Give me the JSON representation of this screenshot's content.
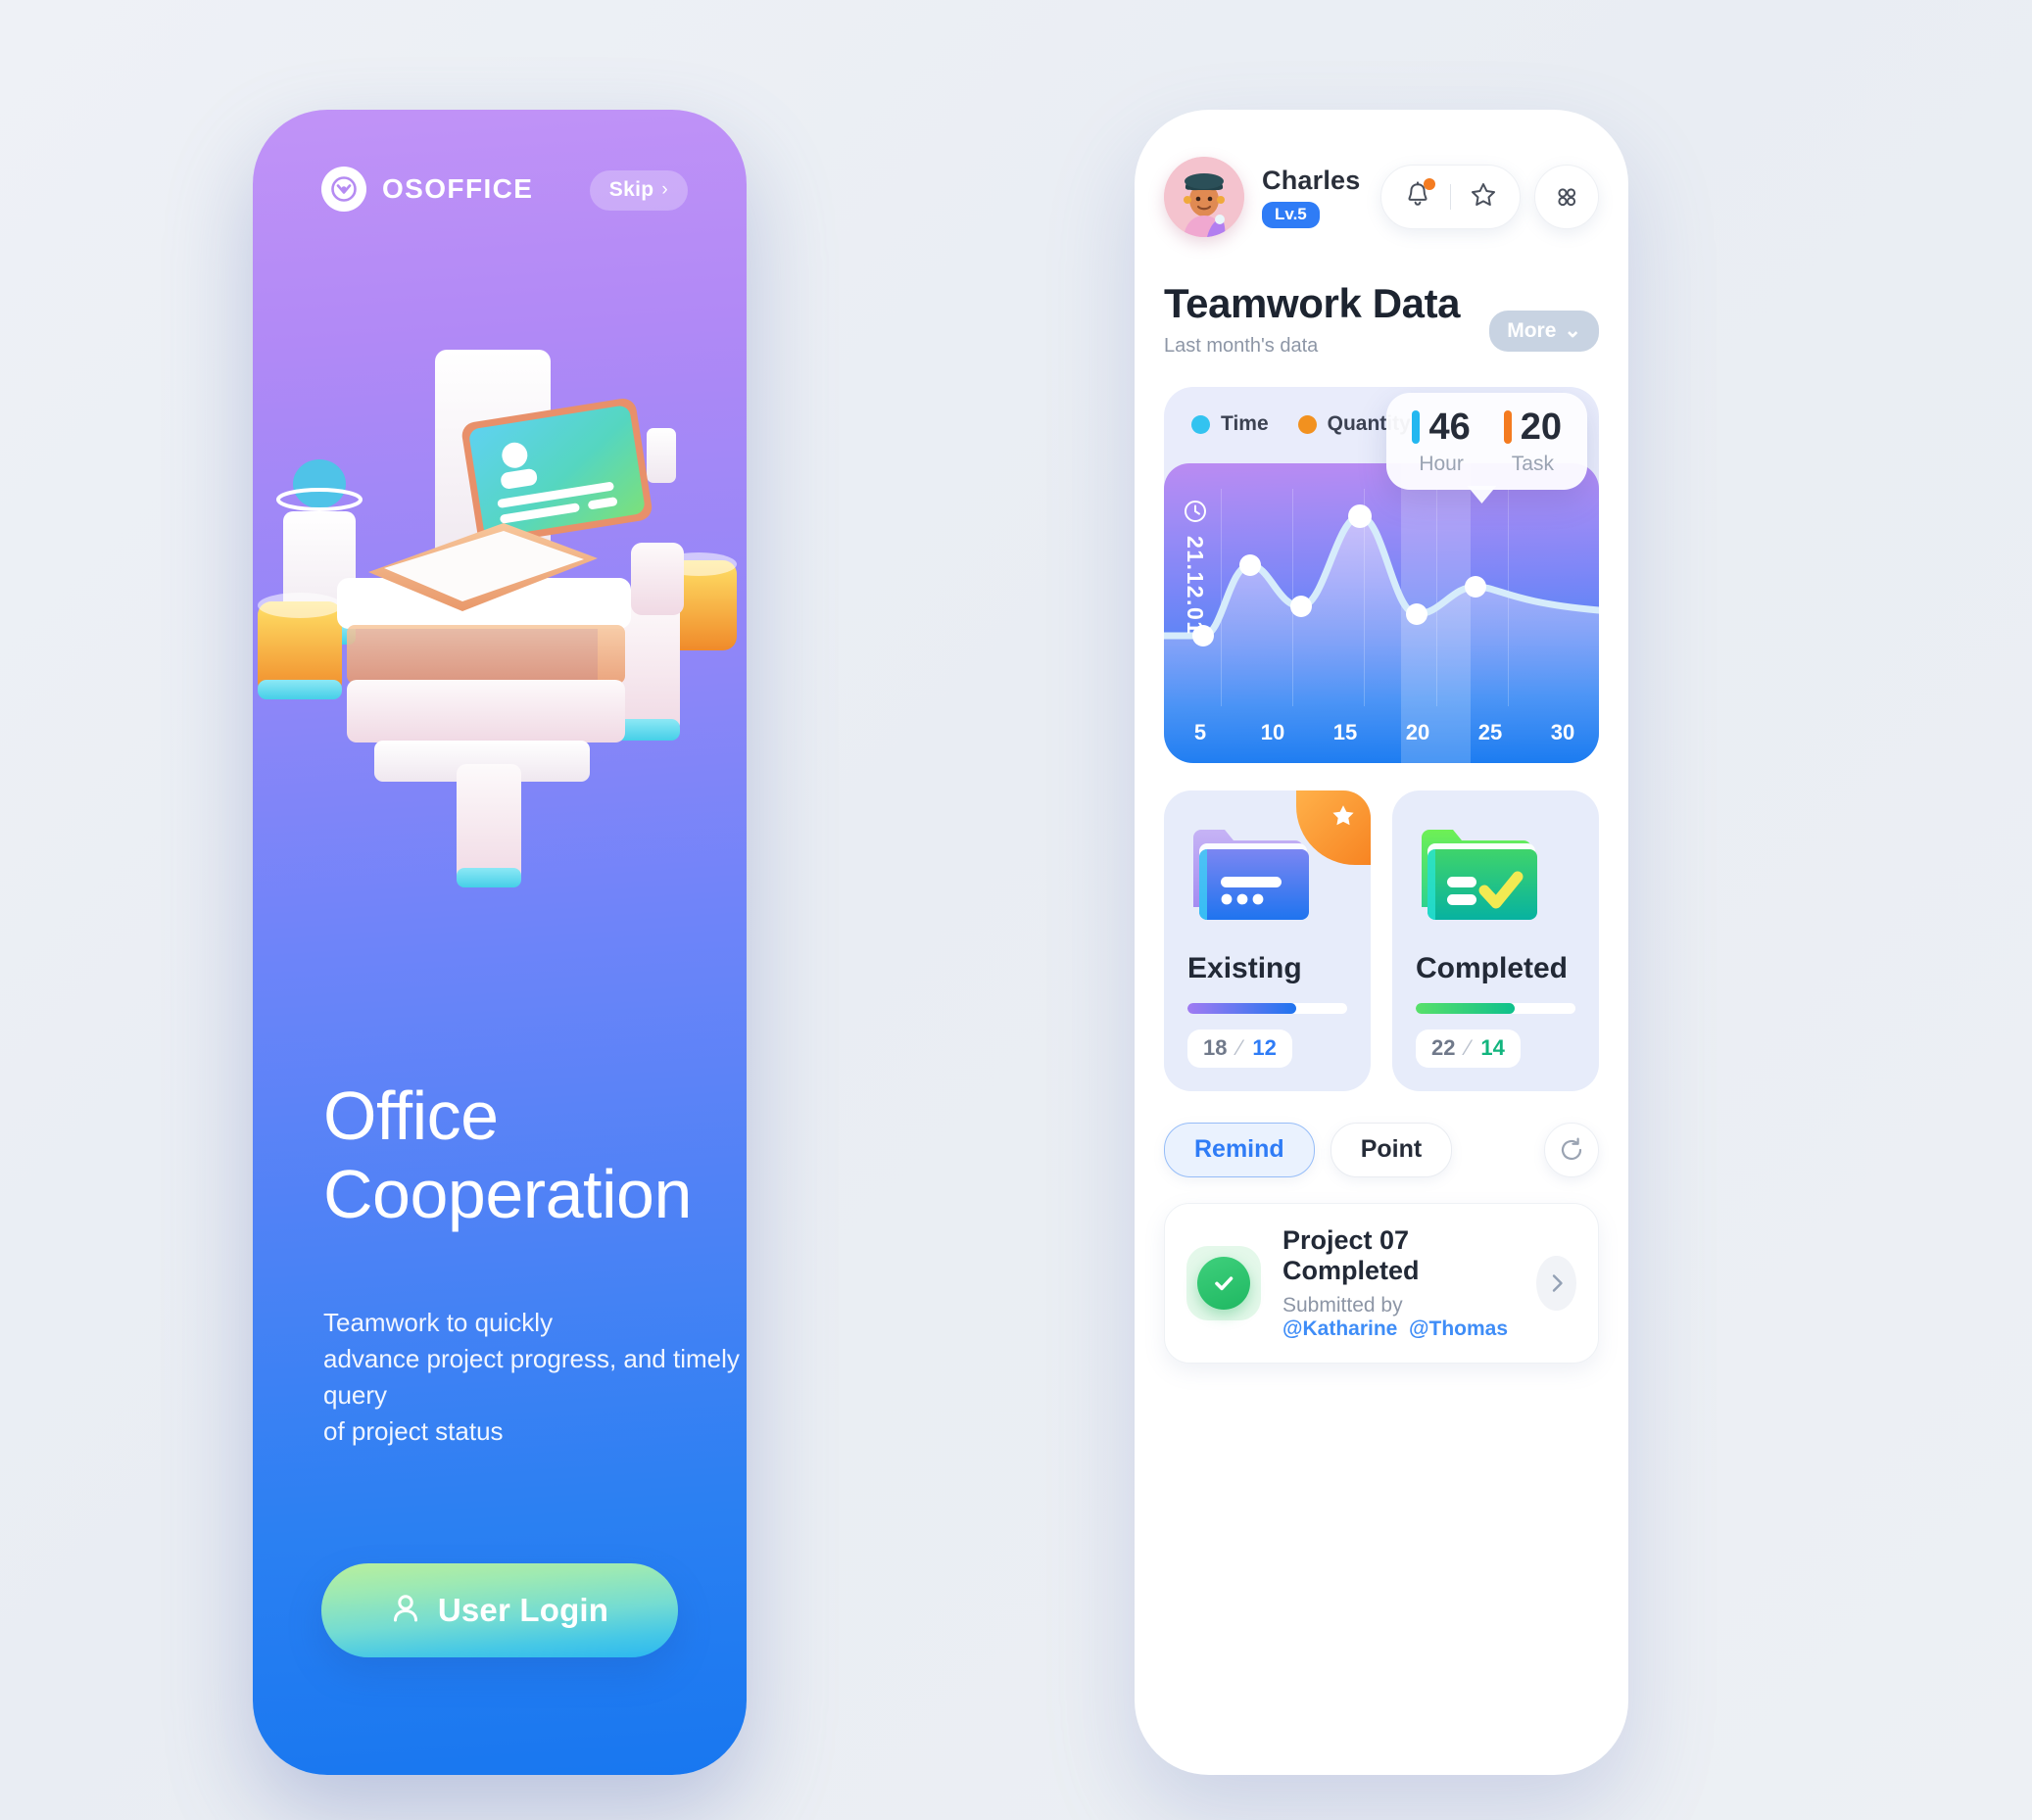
{
  "left_panel": {
    "brand": {
      "name": "OSOFFICE",
      "logo_icon": "osoffice-logo-icon"
    },
    "skip": {
      "label": "Skip",
      "chevron": "›"
    },
    "headline_line1": "Office",
    "headline_line2": "Cooperation",
    "description_line1": "Teamwork to quickly",
    "description_line2": "advance project progress, and timely query",
    "description_line3": "of project status",
    "login_button": {
      "label": "User Login",
      "icon": "user-icon"
    },
    "colors": {
      "gradient_top": "#c193f7",
      "gradient_bottom": "#1877f0",
      "button_from": "#b9ef9c",
      "button_to": "#2bb7f0"
    }
  },
  "right_panel": {
    "user": {
      "name": "Charles",
      "level": "Lv.5",
      "level_color": "#2f7cf6"
    },
    "header_icons": {
      "bell": "bell-icon",
      "bell_badge_color": "#f47b20",
      "star": "star-icon",
      "grid": "grid-menu-icon"
    },
    "section": {
      "title": "Teamwork Data",
      "subtitle": "Last month's data",
      "more_label": "More",
      "more_chevron": "⌄"
    },
    "chart_tooltip": {
      "hour_value": "46",
      "hour_label": "Hour",
      "hour_color": "#23b7f0",
      "task_value": "20",
      "task_label": "Task",
      "task_color": "#f47b20"
    },
    "chart_date": "21.12.01",
    "cards": [
      {
        "title": "Existing",
        "total": "18",
        "slash": "⁄",
        "done": "12",
        "done_color": "#2f7cf6",
        "progress_percent": 68,
        "bar_from": "#a07bf2",
        "bar_to": "#1f74ef",
        "icon": "folder-blue-icon",
        "starred": true,
        "star_icon": "star-filled-icon"
      },
      {
        "title": "Completed",
        "total": "22",
        "slash": "⁄",
        "done": "14",
        "done_color": "#12b57e",
        "progress_percent": 62,
        "bar_from": "#58e06a",
        "bar_to": "#0ec08c",
        "icon": "folder-green-check-icon",
        "starred": false
      }
    ],
    "tabs": [
      {
        "label": "Remind",
        "active": true
      },
      {
        "label": "Point",
        "active": false
      }
    ],
    "refresh_icon": "refresh-icon",
    "list_items": [
      {
        "title": "Project 07 Completed",
        "submitted_prefix": "Submitted by ",
        "mention1": "@Katharine",
        "mention2": "@Thomas",
        "status_icon": "check-circle-icon",
        "chevron_icon": "chevron-right-icon"
      }
    ]
  },
  "chart_data": {
    "type": "area",
    "title": "Teamwork Data",
    "subtitle": "Last month's data",
    "xlabel": "",
    "ylabel": "",
    "categories": [
      "5",
      "10",
      "15",
      "20",
      "25",
      "30"
    ],
    "series": [
      {
        "name": "Time",
        "color": "#33c3f0",
        "values": [
          22,
          52,
          38,
          88,
          34,
          48
        ]
      }
    ],
    "legend": [
      {
        "label": "Time",
        "color": "#33c3f0"
      },
      {
        "label": "Quantity",
        "color": "#f2911f"
      }
    ],
    "legend_position": "top-left",
    "highlighted_category": "20",
    "annotation_date": "21.12.01",
    "tooltip": {
      "hour": 46,
      "task": 20
    },
    "ylim": [
      0,
      100
    ],
    "grid": true
  }
}
